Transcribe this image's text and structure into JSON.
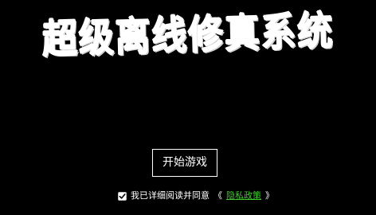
{
  "app": {
    "title": "超级离线修真系统"
  },
  "actions": {
    "start_label": "开始游戏"
  },
  "agreement": {
    "checked": true,
    "text": "我已详细阅读并同意",
    "open_bracket": "《",
    "policy_link": "隐私政策",
    "close_bracket": "》"
  },
  "colors": {
    "background": "#000000",
    "text": "#ffffff",
    "link": "#3ecb2b"
  },
  "icons": {
    "checkbox": "checkmark-icon"
  }
}
